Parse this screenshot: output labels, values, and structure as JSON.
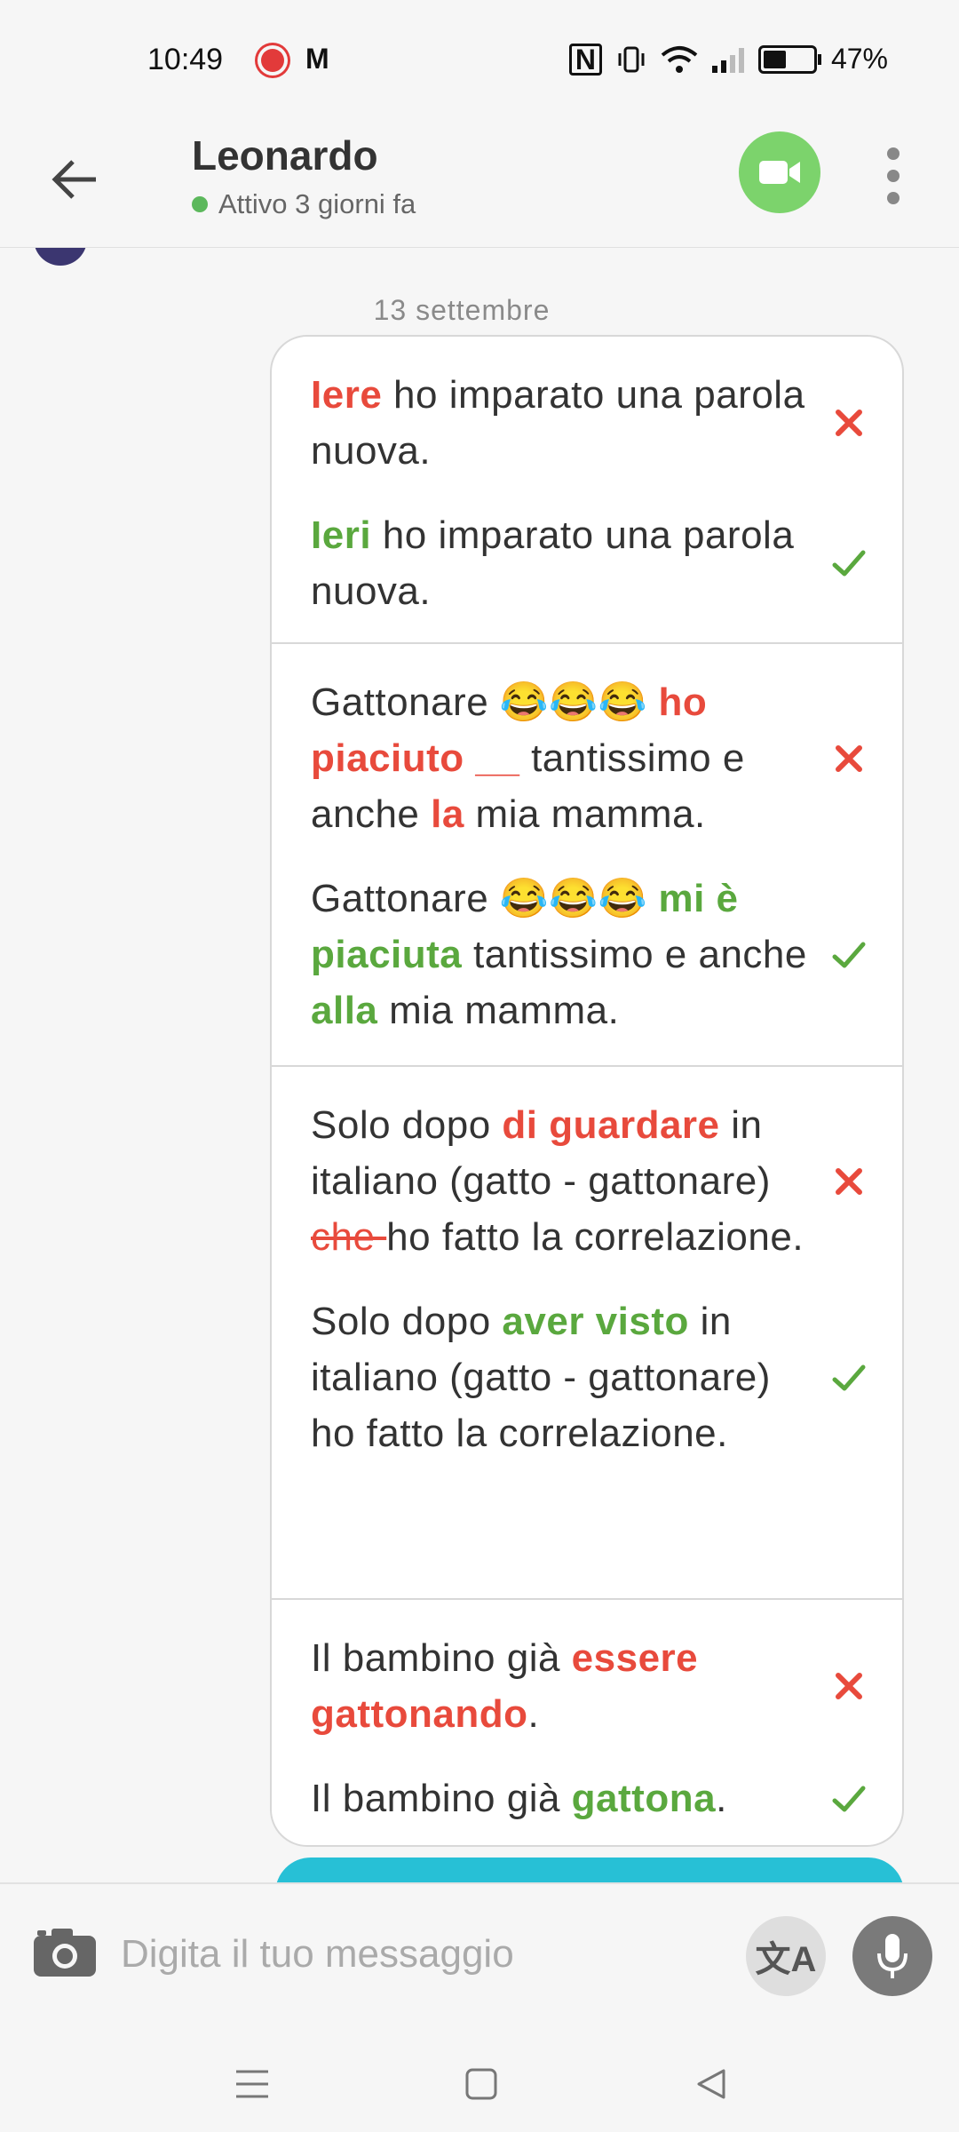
{
  "status_bar": {
    "time": "10:49",
    "mail_glyph": "M",
    "nfc_glyph": "N",
    "battery_level": 0.47,
    "battery_text": "47%",
    "icons": [
      "notification-record-icon",
      "gmail-icon",
      "nfc-icon",
      "vibrate-icon",
      "wifi-icon",
      "signal-icon",
      "battery-icon"
    ]
  },
  "header": {
    "contact_name": "Leonardo",
    "presence": "Attivo 3 giorni fa",
    "presence_color": "#5cb85c",
    "video_color": "#7cd36c"
  },
  "chat": {
    "date_separator": "13 settembre",
    "corrections": [
      {
        "wrong": [
          {
            "t": "Iere",
            "s": "bad"
          },
          {
            "t": " ho imparato una parola nuova.",
            "s": ""
          }
        ],
        "right": [
          {
            "t": "Ieri",
            "s": "good"
          },
          {
            "t": " ho imparato una parola nuova.",
            "s": ""
          }
        ]
      },
      {
        "wrong": [
          {
            "t": "Gattonare 😂😂😂 ",
            "s": ""
          },
          {
            "t": "ho piaciuto __",
            "s": "bad"
          },
          {
            "t": " tantissimo e anche ",
            "s": ""
          },
          {
            "t": "la",
            "s": "bad"
          },
          {
            "t": " mia mamma.",
            "s": ""
          }
        ],
        "right": [
          {
            "t": "Gattonare 😂😂😂 ",
            "s": ""
          },
          {
            "t": "mi è piaciuta",
            "s": "good"
          },
          {
            "t": " tantissimo e anche ",
            "s": ""
          },
          {
            "t": "alla",
            "s": "good"
          },
          {
            "t": " mia mamma.",
            "s": ""
          }
        ]
      },
      {
        "wrong": [
          {
            "t": "Solo dopo ",
            "s": ""
          },
          {
            "t": "di guardare",
            "s": "bad"
          },
          {
            "t": " in italiano (gatto - gattonare) ",
            "s": ""
          },
          {
            "t": "che ",
            "s": "strike"
          },
          {
            "t": "ho fatto la correlazione.",
            "s": ""
          }
        ],
        "right": [
          {
            "t": "Solo dopo ",
            "s": ""
          },
          {
            "t": "aver visto",
            "s": "good"
          },
          {
            "t": " in italiano (gatto - gattonare) ho fatto la correlazione.",
            "s": ""
          }
        ]
      },
      {
        "wrong": [
          {
            "t": "Il bambino già ",
            "s": ""
          },
          {
            "t": "essere gattonando",
            "s": "bad"
          },
          {
            "t": ".",
            "s": ""
          }
        ],
        "right": [
          {
            "t": "Il bambino già ",
            "s": ""
          },
          {
            "t": "gattona",
            "s": "good"
          },
          {
            "t": ".",
            "s": ""
          }
        ]
      }
    ],
    "wrong_color": "#e84a3c",
    "right_color": "#5aa83e",
    "next_bubble_color": "#27c0d6"
  },
  "composer": {
    "placeholder": "Digita il tuo messaggio",
    "translate_glyph": "文A"
  },
  "navbar": {
    "icons": [
      "menu-icon",
      "home-square-icon",
      "back-triangle-icon"
    ]
  }
}
